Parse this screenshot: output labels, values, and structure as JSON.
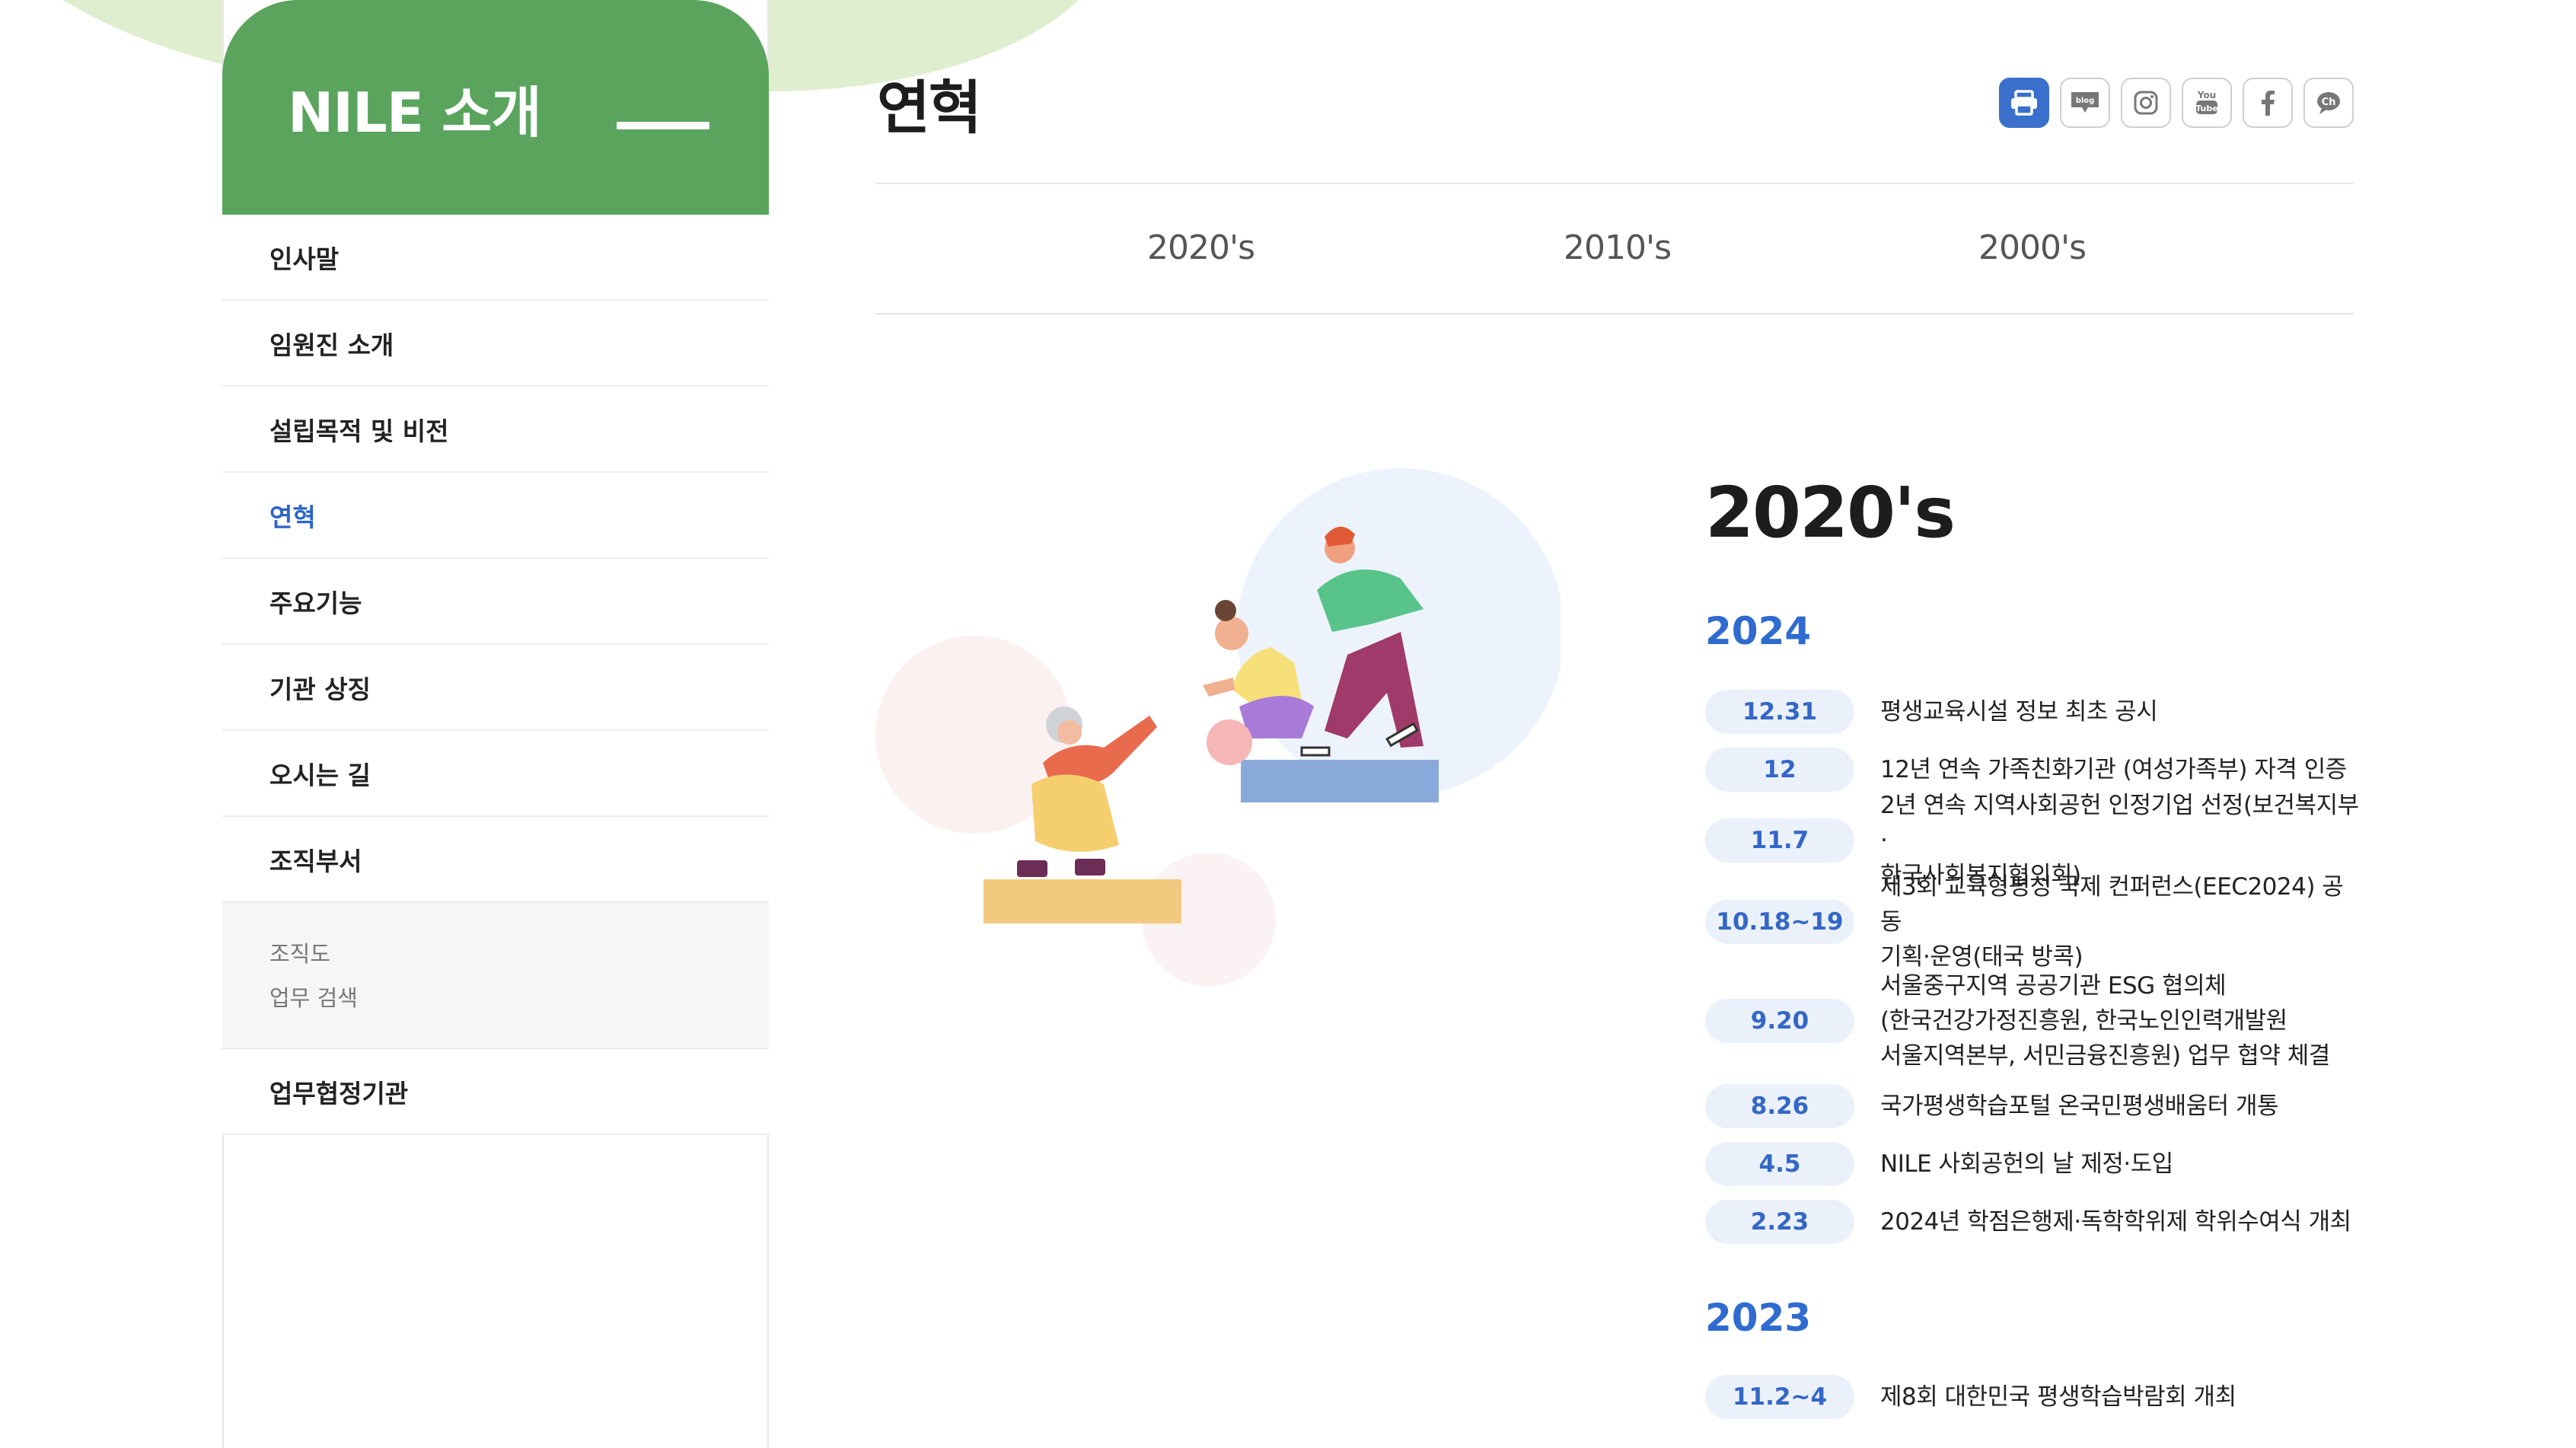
{
  "sidebar": {
    "title": "NILE 소개",
    "items": [
      {
        "label": "인사말"
      },
      {
        "label": "임원진 소개"
      },
      {
        "label": "설립목적 및 비전"
      },
      {
        "label": "연혁"
      },
      {
        "label": "주요기능"
      },
      {
        "label": "기관 상징"
      },
      {
        "label": "오시는 길"
      },
      {
        "label": "조직부서"
      }
    ],
    "sub_items": [
      {
        "label": "조직도"
      },
      {
        "label": "업무 검색"
      }
    ],
    "last_item": {
      "label": "업무협정기관"
    },
    "active_label": "연혁",
    "colors": {
      "header_bg": "#5aa45e",
      "active_text": "#2c63c6"
    }
  },
  "header": {
    "title": "연혁",
    "sns_icons": [
      "print-icon",
      "blog-icon",
      "instagram-icon",
      "youtube-icon",
      "facebook-icon",
      "kakao-channel-icon"
    ]
  },
  "tabs": [
    {
      "label": "2020's"
    },
    {
      "label": "2010's"
    },
    {
      "label": "2000's"
    }
  ],
  "history": {
    "decade": "2020's",
    "years": [
      {
        "year": "2024",
        "events": [
          {
            "date": "12.31",
            "lines": [
              "평생교육시설 정보 최초 공시"
            ]
          },
          {
            "date": "12",
            "lines": [
              "12년 연속 가족친화기관 (여성가족부) 자격 인증"
            ]
          },
          {
            "date": "11.7",
            "lines": [
              "2년 연속 지역사회공헌 인정기업 선정(보건복지부·",
              "한국사회복지협의회)"
            ]
          },
          {
            "date": "10.18~19",
            "lines": [
              "제3회 교육형평성 국제 컨퍼런스(EEC2024) 공동",
              "기획·운영(태국 방콕)"
            ]
          },
          {
            "date": "9.20",
            "lines": [
              "서울중구지역 공공기관 ESG 협의체",
              "(한국건강가정진흥원, 한국노인인력개발원",
              "서울지역본부, 서민금융진흥원) 업무 협약 체결"
            ]
          },
          {
            "date": "8.26",
            "lines": [
              "국가평생학습포털 온국민평생배움터 개통"
            ]
          },
          {
            "date": "4.5",
            "lines": [
              "NILE 사회공헌의 날 제정·도입"
            ]
          },
          {
            "date": "2.23",
            "lines": [
              "2024년 학점은행제·독학학위제 학위수여식 개최"
            ]
          }
        ]
      },
      {
        "year": "2023",
        "events": [
          {
            "date": "11.2~4",
            "lines": [
              "제8회 대한민국 평생학습박람회 개최"
            ]
          }
        ]
      }
    ],
    "colors": {
      "year": "#2f6bd0",
      "pill_bg": "#ebf1fb",
      "pill_text": "#3467c6"
    }
  }
}
